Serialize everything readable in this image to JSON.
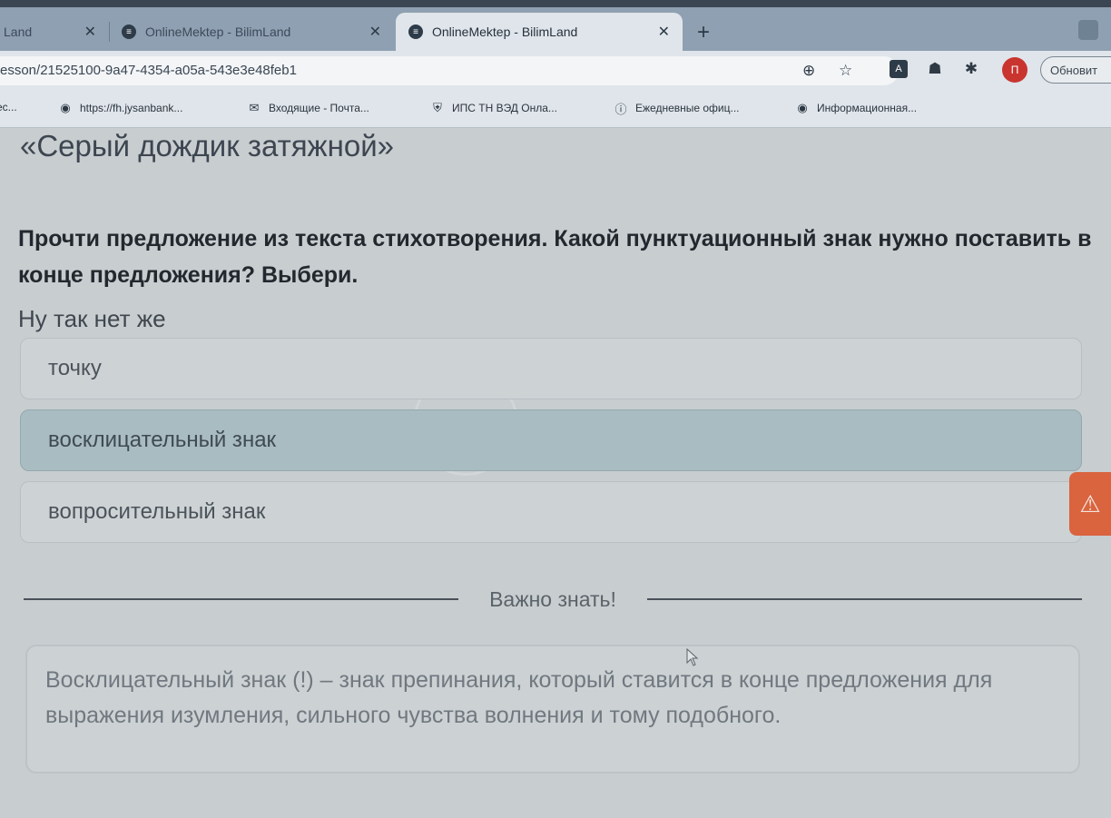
{
  "browser": {
    "tabs": [
      {
        "title": "Land",
        "favicon": "globe-icon",
        "active": false
      },
      {
        "title": "OnlineMektep - BilimLand",
        "favicon": "bilimland-icon",
        "active": false
      },
      {
        "title": "OnlineMektep - BilimLand",
        "favicon": "bilimland-icon",
        "active": true
      }
    ],
    "new_tab_label": "+",
    "url": "esson/21525100-9a47-4354-a05a-543e3e48feb1",
    "avatar_letter": "П",
    "update_button": "Обновит",
    "bookmarks": [
      {
        "label": "ес...",
        "icon": "globe-icon"
      },
      {
        "label": "https://fh.jysanbank...",
        "icon": "globe-icon"
      },
      {
        "label": "Входящие - Почта...",
        "icon": "mail-icon"
      },
      {
        "label": "ИПС ТН ВЭД Онла...",
        "icon": "shield-icon"
      },
      {
        "label": "Ежедневные офиц...",
        "icon": "info-circle-icon"
      },
      {
        "label": "Информационная...",
        "icon": "globe-icon"
      }
    ]
  },
  "lesson": {
    "title": "«Серый дождик затяжной»",
    "question": "Прочти предложение из текста стихотворения. Какой пунктуационный знак нужно поставить в конце предложения? Выбери.",
    "sentence": "Ну так нет же",
    "options": [
      {
        "label": "точку",
        "selected": false
      },
      {
        "label": "восклицательный знак",
        "selected": true
      },
      {
        "label": "вопросительный знак",
        "selected": false
      }
    ],
    "divider_label": "Важно знать!",
    "info_text": "Восклицательный знак (!) – знак препинания, который ставится в конце предложения для выражения изумления, сильного чувства волнения и тому подобного."
  },
  "colors": {
    "selected_option": "#a9bcc1",
    "report_tab": "#d9643e",
    "page_background": "#c8cdd0"
  }
}
